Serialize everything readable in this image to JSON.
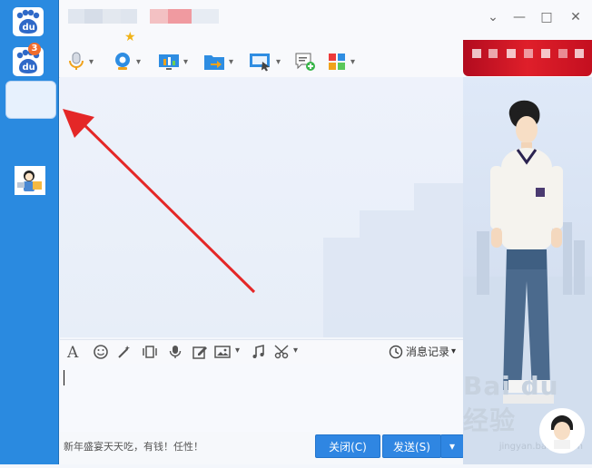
{
  "header": {
    "title_blurred": ""
  },
  "input_toolbar": {
    "history_label": "消息记录"
  },
  "bottom": {
    "tip_text": "新年盛宴天天吃，有钱！任性！",
    "close_label": "关闭(C)",
    "send_label": "发送(S)"
  },
  "sidebar": {
    "badge_count": "3"
  },
  "watermark": {
    "text": "Bai du 经验",
    "sub": "jingyan.baidu.com"
  },
  "colors": {
    "sidebar": "#2a8ae0",
    "button": "#2f86e2",
    "arrow": "#e42727",
    "banner": "#d6182a"
  }
}
